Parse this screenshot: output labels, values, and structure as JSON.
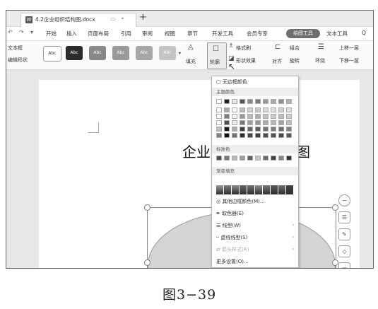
{
  "window": {
    "doc_title": "4.2企业组织结构图.docx",
    "doc_icon": "W",
    "new_tab": "+"
  },
  "menu": {
    "undo": "↶",
    "redo": "↷",
    "more": "▾",
    "items": [
      "开始",
      "插入",
      "页面布局",
      "引用",
      "审阅",
      "视图",
      "章节",
      "开发工具",
      "会员专享"
    ],
    "active_pill": "绘图工具",
    "after_pill": "文本工具",
    "search": "Q"
  },
  "ribbon": {
    "textbox": "文本框",
    "shape_format": "编辑形状",
    "style_swatches": [
      "Abc",
      "Abc",
      "Abc",
      "Abc",
      "Abc",
      "Abc"
    ],
    "fill": "填充",
    "outline": "轮廓",
    "format_brush": "格式刷",
    "shape_effect": "形状效果",
    "align": "对齐",
    "group": "组合",
    "rotate": "旋转",
    "wrap": "环绕",
    "bring_forward": "上移一层",
    "send_backward": "下移一层"
  },
  "document": {
    "heading_left": "企业",
    "heading_right": "图"
  },
  "dropdown": {
    "no_outline": "无边框颜色",
    "theme_colors": "主题颜色",
    "standard_colors": "标准色",
    "gradient_fill": "渐变填充",
    "more_colors": "其他边框颜色(M)...",
    "eyedropper": "取色器(E)",
    "line_weight": "线型(W)",
    "dash_type": "虚线线型(S)",
    "arrow_style": "箭头样式(R)",
    "more_settings": "更多设置(O)..."
  },
  "colors": {
    "theme_top": [
      "#ffffff",
      "#222222",
      "#e6e6e6",
      "#555555",
      "#8a8a8a",
      "#7a7a7a",
      "#9a9a9a",
      "#a8a8a8",
      "#8f8f8f",
      "#b0b0b0"
    ],
    "standard": [
      "#4d4d4d",
      "#777777",
      "#b8b8b8",
      "#9d9d9d",
      "#5e5e5e",
      "#c6c6c6",
      "#6a6a6a",
      "#444444",
      "#888888",
      "#333333"
    ],
    "gradient": [
      "#9a9a9a",
      "#7e7e7e",
      "#8a8a8a",
      "#666666",
      "#707070",
      "#909090",
      "#7a7a7a",
      "#5a5a5a",
      "#6e6e6e",
      "#444444"
    ]
  },
  "caption": "图3−39"
}
